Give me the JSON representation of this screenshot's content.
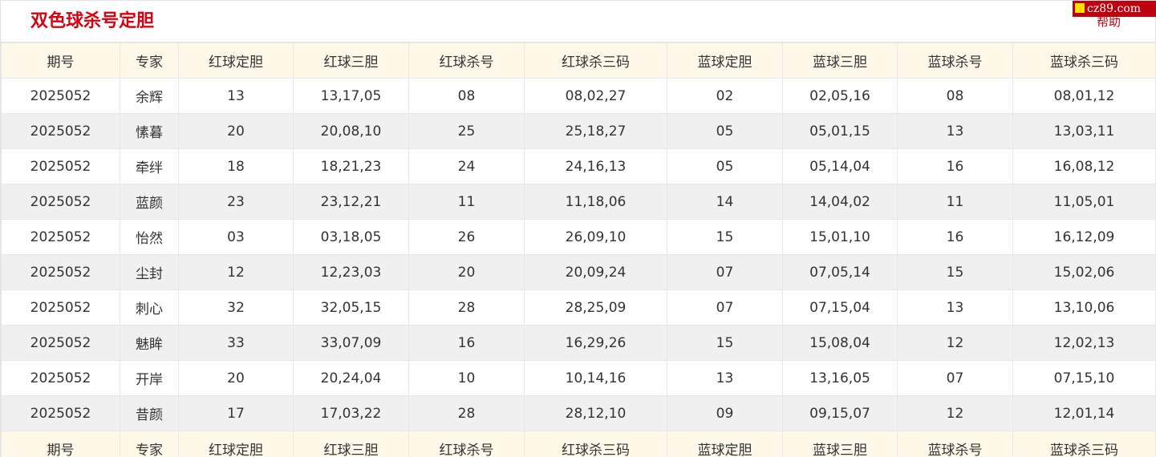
{
  "header": {
    "title": "双色球杀号定胆",
    "brand": "cz89.com",
    "help": "帮助",
    "brand_color": "#c0000f",
    "title_color": "#d6000f"
  },
  "table": {
    "columns": [
      "期号",
      "专家",
      "红球定胆",
      "红球三胆",
      "红球杀号",
      "红球杀三码",
      "蓝球定胆",
      "蓝球三胆",
      "蓝球杀号",
      "蓝球杀三码"
    ],
    "rows": [
      [
        "2025052",
        "余辉",
        "13",
        "13,17,05",
        "08",
        "08,02,27",
        "02",
        "02,05,16",
        "08",
        "08,01,12"
      ],
      [
        "2025052",
        "愫暮",
        "20",
        "20,08,10",
        "25",
        "25,18,27",
        "05",
        "05,01,15",
        "13",
        "13,03,11"
      ],
      [
        "2025052",
        "牵绊",
        "18",
        "18,21,23",
        "24",
        "24,16,13",
        "05",
        "05,14,04",
        "16",
        "16,08,12"
      ],
      [
        "2025052",
        "蓝颜",
        "23",
        "23,12,21",
        "11",
        "11,18,06",
        "14",
        "14,04,02",
        "11",
        "11,05,01"
      ],
      [
        "2025052",
        "怡然",
        "03",
        "03,18,05",
        "26",
        "26,09,10",
        "15",
        "15,01,10",
        "16",
        "16,12,09"
      ],
      [
        "2025052",
        "尘封",
        "12",
        "12,23,03",
        "20",
        "20,09,24",
        "07",
        "07,05,14",
        "15",
        "15,02,06"
      ],
      [
        "2025052",
        "刺心",
        "32",
        "32,05,15",
        "28",
        "28,25,09",
        "07",
        "07,15,04",
        "13",
        "13,10,06"
      ],
      [
        "2025052",
        "魅眸",
        "33",
        "33,07,09",
        "16",
        "16,29,26",
        "15",
        "15,08,04",
        "12",
        "12,02,13"
      ],
      [
        "2025052",
        "开岸",
        "20",
        "20,24,04",
        "10",
        "10,14,16",
        "13",
        "13,16,05",
        "07",
        "07,15,10"
      ],
      [
        "2025052",
        "昔颜",
        "17",
        "17,03,22",
        "28",
        "28,12,10",
        "09",
        "09,15,07",
        "12",
        "12,01,14"
      ]
    ]
  }
}
